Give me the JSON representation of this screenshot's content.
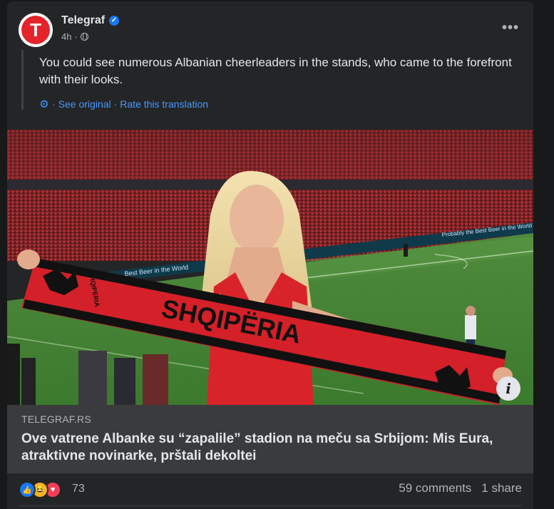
{
  "post": {
    "page_name": "Telegraf",
    "time": "4h",
    "avatar_letter": "T",
    "text": "You could see numerous Albanian cheerleaders in the stands, who came to the forefront with their looks.",
    "translation": {
      "separator": "·",
      "see_original": "See original",
      "dot": "·",
      "rate": "Rate this translation"
    },
    "image": {
      "scarf_text": "SHQIPËRIA",
      "scarf_small_text": "SHQIPERIA",
      "banner_text": "Best Beer in the World",
      "banner_text_2": "Probably the Best Beer in the World"
    },
    "link": {
      "domain": "TELEGRAF.RS",
      "title": "Ove vatrene Albanke su “zapalile” stadion na meču sa Srbijom: Mis Eura, atraktivne novinarke, prštali dekoltei"
    },
    "reactions": {
      "icons": [
        "like-icon",
        "haha-icon",
        "love-icon"
      ],
      "count": "73",
      "comments": "59 comments",
      "shares": "1 share"
    }
  },
  "colors": {
    "background": "#18191a",
    "card": "#242526",
    "link_box": "#3a3b3c",
    "accent": "#4599ff",
    "brand_red": "#e4232b"
  }
}
